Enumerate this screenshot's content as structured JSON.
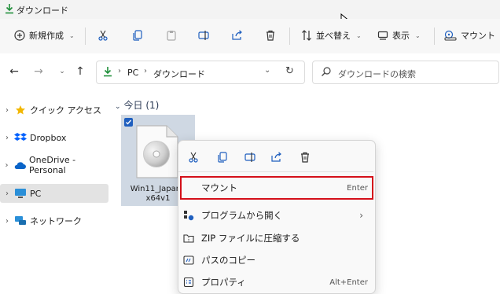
{
  "window": {
    "title": "ダウンロード"
  },
  "ribbon": {
    "new_label": "新規作成",
    "sort_label": "並べ替え",
    "view_label": "表示",
    "mount_label": "マウント"
  },
  "address": {
    "crumbs": [
      "PC",
      "ダウンロード"
    ],
    "search_placeholder": "ダウンロードの検索"
  },
  "sidebar": {
    "items": [
      {
        "label": "クイック アクセス"
      },
      {
        "label": "Dropbox"
      },
      {
        "label": "OneDrive - Personal"
      },
      {
        "label": "PC"
      },
      {
        "label": "ネットワーク"
      }
    ]
  },
  "content": {
    "group_label": "今日 (1)",
    "file_name_line1": "Win11_Japane",
    "file_name_line2": "x64v1"
  },
  "context_menu": {
    "items": [
      {
        "label": "マウント",
        "shortcut": "Enter"
      },
      {
        "label": "プログラムから開く",
        "shortcut": ""
      },
      {
        "label": "ZIP ファイルに圧縮する",
        "shortcut": ""
      },
      {
        "label": "パスのコピー",
        "shortcut": ""
      },
      {
        "label": "プロパティ",
        "shortcut": "Alt+Enter"
      }
    ]
  },
  "colors": {
    "accent": "#1f5fbf",
    "highlight_border": "#d4101a",
    "download_green": "#1f8f3a"
  }
}
